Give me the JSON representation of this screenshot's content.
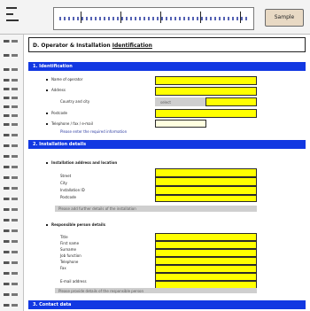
{
  "toolbar": {
    "sample_button": "Sample"
  },
  "title": {
    "text_prefix": "D. Operator & Installation",
    "text_underlined": "Identification"
  },
  "sections": [
    {
      "label": "1. Identification"
    },
    {
      "label": "2. Installation details"
    },
    {
      "label": "3. Contact data"
    }
  ],
  "section1": {
    "fields": [
      {
        "label": "Name of operator"
      },
      {
        "label": "Address"
      },
      {
        "label": "Country and city"
      },
      {
        "label": "Postcode"
      },
      {
        "label": "Telephone / fax / e-mail"
      }
    ],
    "country_hint": "select",
    "helper": "Please enter the required information"
  },
  "section2": {
    "group_a_label": "Installation address and location",
    "group_a_fields": [
      {
        "label": "Street"
      },
      {
        "label": "City"
      },
      {
        "label": "Installation ID"
      },
      {
        "label": "Postcode"
      }
    ],
    "group_a_helper": "Please add further details of the installation",
    "group_b_label": "Responsible person details",
    "group_b_fields": [
      {
        "label": "Title"
      },
      {
        "label": "First name"
      },
      {
        "label": "Surname"
      },
      {
        "label": "Job function"
      },
      {
        "label": "Telephone"
      },
      {
        "label": "Fax"
      },
      {
        "label": "E-mail address"
      }
    ],
    "group_b_helper": "Please provide details of the responsible person"
  }
}
